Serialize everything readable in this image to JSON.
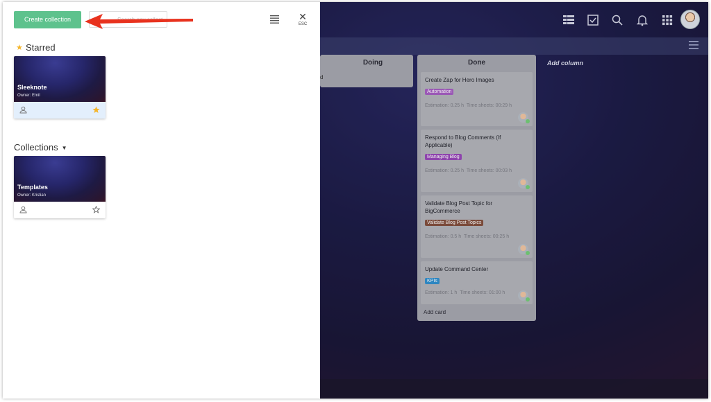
{
  "panel": {
    "create_button": "Create collection",
    "search_placeholder": "Search any collection",
    "close_label": "ESC",
    "starred_title": "Starred",
    "collections_title": "Collections",
    "starred": [
      {
        "name": "Sleeknote",
        "owner": "Owner: Emil",
        "starred": true
      }
    ],
    "collections": [
      {
        "name": "Templates",
        "owner": "Owner: Kristian",
        "starred": false
      }
    ]
  },
  "board": {
    "columns": [
      {
        "title": "Doing",
        "stub_text": "d"
      },
      {
        "title": "Done",
        "cards": [
          {
            "title": "Create Zap for Hero Images",
            "tag": "Automation",
            "tag_color": "#9b59b6",
            "estimation": "Estimation: 0.25 h",
            "time_sheets": "Time sheets: 00:29 h"
          },
          {
            "title": "Respond to Blog Comments (If Applicable)",
            "tag": "Managing Blog",
            "tag_color": "#8e44ad",
            "estimation": "Estimation: 0.25 h",
            "time_sheets": "Time sheets: 00:03 h"
          },
          {
            "title": "Validate Blog Post Topic for BigCommerce",
            "tag": "Validate Blog Post Topics",
            "tag_color": "#7a4a3a",
            "estimation": "Estimation: 0.5 h",
            "time_sheets": "Time sheets: 00:25 h"
          },
          {
            "title": "Update Command Center",
            "tag": "KPIs",
            "tag_color": "#2e86c1",
            "estimation": "Estimation: 1 h",
            "time_sheets": "Time sheets: 01:00 h"
          }
        ],
        "add_card": "Add card"
      }
    ],
    "add_column": "Add column"
  },
  "colors": {
    "accent": "#5ec28d",
    "star": "#f5b52a",
    "arrow": "#e8321e"
  }
}
